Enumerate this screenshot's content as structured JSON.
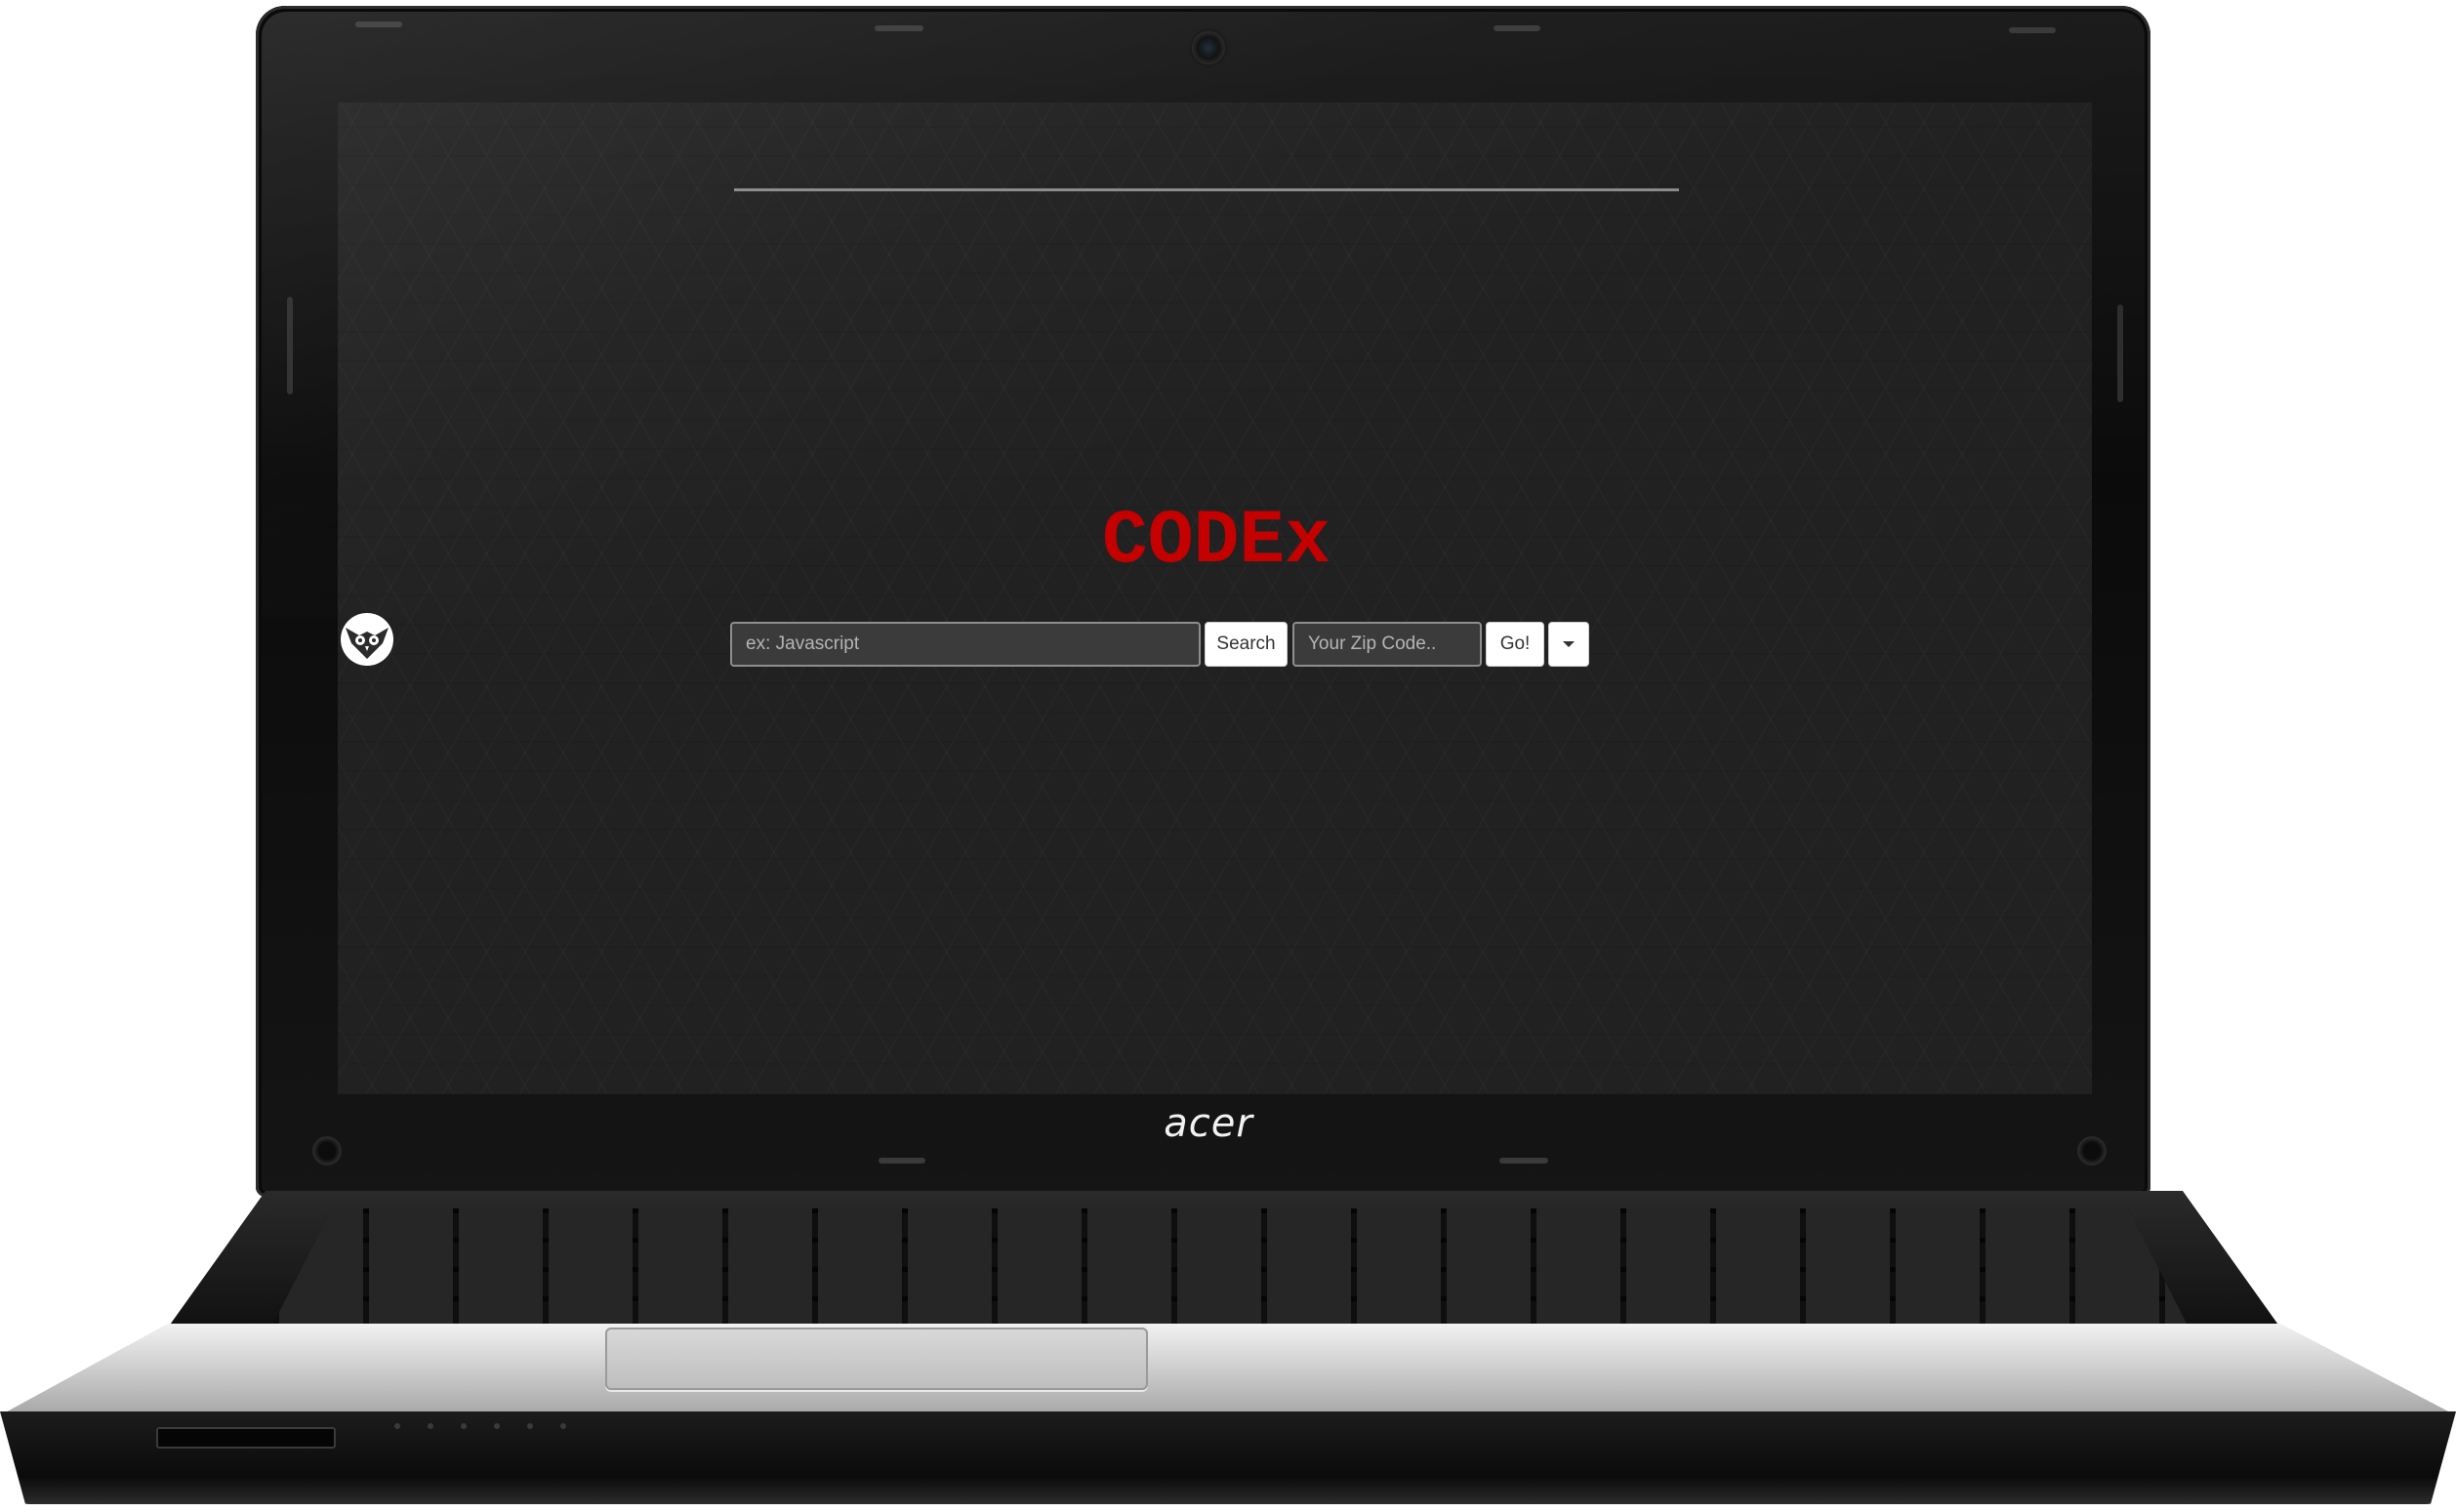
{
  "device": {
    "brand_logo": "acer"
  },
  "page": {
    "title": "CODEx",
    "title_color": "#c40000",
    "background_color": "#212121",
    "owl_icon": "owl-logo-icon"
  },
  "search": {
    "keyword_placeholder": "ex: Javascript",
    "search_button_label": "Search",
    "zip_placeholder": "Your Zip Code..",
    "go_button_label": "Go!",
    "dropdown_icon": "caret-down-icon"
  }
}
